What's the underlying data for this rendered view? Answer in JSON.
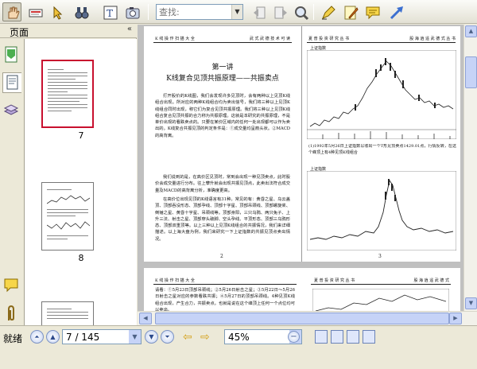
{
  "toolbar": {
    "search_placeholder": "查找:",
    "colors": {
      "active_border": "#8c8a7a"
    },
    "icons": [
      "hand-icon",
      "select-text-icon",
      "pointer-icon",
      "binoculars-icon",
      "text-select-icon",
      "snapshot-icon",
      "prev-result-icon",
      "next-result-icon",
      "search-icon",
      "highlighter-icon",
      "note-edit-icon",
      "comment-icon",
      "arrow-icon"
    ]
  },
  "left_panel": {
    "title": "页面",
    "collapse": "«",
    "tabs": [
      "pages-tab",
      "document-tab",
      "layers-tab",
      "comments-tab",
      "attachments-tab"
    ],
    "thumbnails": [
      {
        "label": "7",
        "selected": true
      },
      {
        "label": "8",
        "selected": false
      },
      {
        "label": "",
        "selected": false
      }
    ]
  },
  "document": {
    "page_left": {
      "header_left": "K 线 操 作 扫 描 大 全",
      "header_right": "武 式 武 德 技 术 可 读",
      "lecture": "第一讲",
      "title": "K线复合见顶共振原理——共振卖点",
      "paragraphs": [
        "打开股价的K线图，我们会发现许多见顶时，会有两种以上见顶K线组合出现。所对应的两种K线组合均为卖出信号，我们将三种以上见顶K线组合同时出现，称它们为复合见顶共振原理。我们将三种以上见顶K线组合复合见顶共振的合力称为共振原理。这就是本研究的共振原理，不是单价出现的看跌卖点的。只要在某价区域内的任何一处出现都可以作为卖出的。K线复合共振见顶的判定条件是：①成交量均呈箭头状。②MACD的高背离。",
        "我们说到的是，在高价区见顶时，常到会出现一种见顶卖点，此时股价会成交量进行分布。往上攀升就会出现共振见顶点，此卖出法符合成交量及MACD的高背离分析，准确度更高。",
        "在高价位出现见顶的K线语言有31种。常见的有：黄昏之星、乌云盖顶、顶部吞没形态、顶部孕线、顶部十字星、顶部吊颈线、顶部螺旋桨、倒锤之星、黄昏十字星、吊颈线等。顶部身阳，三只乌鸦、两只兔子、上升三法、射击之星、顶部穿头破脚、空头孕线、平顶形态、顶部三乌鸦形态、顶部双重顶等。以上三种以上见顶K线组合的共振情况，我们来详细描述。以上海大盘为例，我们来研究一下上证指数的共振见顶点卖出情况。"
      ],
      "page_number": "2"
    },
    "page_right": {
      "header_left": "夏 普 投 资 研 究 丛 书",
      "header_right": "股 海 逍 遥 武 德 式 丛 书",
      "caption_top": "上证指数",
      "caption_mid": "上证指数",
      "figure_caption": "(1)1992年5月26日上证指数以收出一个T形见顶卖点1429.01点，行情反转，在这个峰顶上有4种见顶K线组合",
      "page_number": "3"
    },
    "page_bottom": {
      "header_left": "K 线 操 作 扫 描 大 全",
      "header_right": "夏 普 投 资 研 究 丛 书",
      "header_right2": "股 海 逍 遥 武 德 式",
      "body": "请看：①5月23日顶部吊颈线；②5月26日射击之星；③5月22日～5月26日射击之星对应的参数看跌共振；④5月27日的顶部吊颈线。4种见顶K线组合出现，产生合力，共振卖点。也就是说在这个峰顶上任何一个点位均可以卖出。"
    }
  },
  "statusbar": {
    "status": "就绪",
    "page_indicator": "7 / 145",
    "zoom": "45%"
  }
}
